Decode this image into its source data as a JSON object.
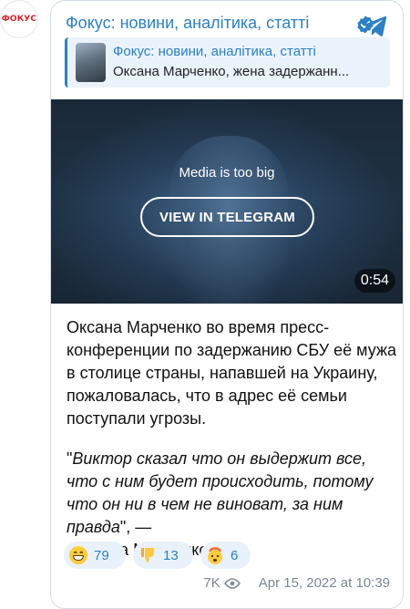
{
  "avatar": {
    "label": "ФОКУС"
  },
  "post": {
    "channel_name": "Фокус: новини, аналітика, статті",
    "reply": {
      "title": "Фокус: новини, аналітика, статті",
      "text": "Оксана Марченко, жена задержанн..."
    },
    "media": {
      "message": "Media is too big",
      "button_label": "VIEW IN TELEGRAM",
      "duration": "0:54"
    },
    "text_paragraph_1": "Оксана Марченко во время пресс-конференции по задержанию СБУ её мужа в столице страны, напавшей на Украину, пожаловалась, что в адрес её семьи поступали угрозы.",
    "quote_open": "\"",
    "quote_text": "Виктор сказал что он выдержит все, что с ним будет происходить, потому что он ни в чем не виноват, за ним правда",
    "quote_close": "\", —",
    "quote_after": "заявила Марченко.",
    "reactions": [
      {
        "emoji": "grinning-face",
        "count": "79"
      },
      {
        "emoji": "thumbs-down",
        "count": "13"
      },
      {
        "emoji": "exploding-head",
        "count": "6"
      }
    ],
    "views": "7K",
    "date": "Apr 15, 2022 at 10:39"
  },
  "colors": {
    "accent": "#2d80c3",
    "reply_bg": "#eaf3fb",
    "reaction_bg": "#e9f2fb",
    "meta_text": "#7b8794",
    "brand_red": "#d6232a"
  }
}
